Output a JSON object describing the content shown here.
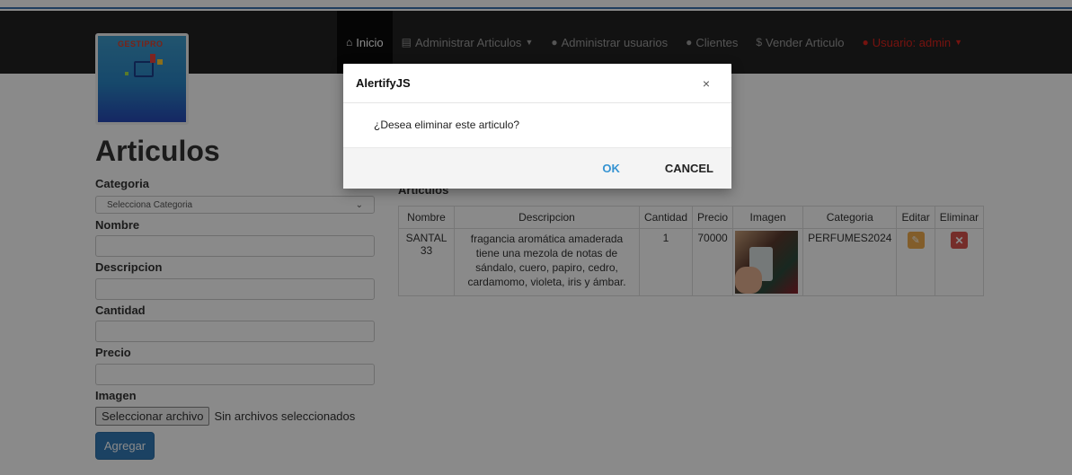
{
  "logo": {
    "text": "GESTIPRO"
  },
  "nav": {
    "items": [
      {
        "label": "Inicio",
        "icon": "home-icon"
      },
      {
        "label": "Administrar Articulos",
        "icon": "list-icon"
      },
      {
        "label": "Administrar usuarios",
        "icon": "user-icon"
      },
      {
        "label": "Clientes",
        "icon": "user-icon"
      },
      {
        "label": "Vender Articulo",
        "icon": "dollar-icon"
      },
      {
        "label": "Usuario: admin",
        "icon": "user-icon"
      }
    ]
  },
  "form": {
    "title": "Articulos",
    "categoria_label": "Categoria",
    "categoria_selected": "Selecciona Categoria",
    "nombre_label": "Nombre",
    "descripcion_label": "Descripcion",
    "cantidad_label": "Cantidad",
    "precio_label": "Precio",
    "imagen_label": "Imagen",
    "file_button": "Seleccionar archivo",
    "file_status": "Sin archivos seleccionados",
    "submit_label": "Agregar"
  },
  "table": {
    "heading": "Articulos",
    "columns": [
      "Nombre",
      "Descripcion",
      "Cantidad",
      "Precio",
      "Imagen",
      "Categoria",
      "Editar",
      "Eliminar"
    ],
    "rows": [
      {
        "nombre": "SANTAL 33",
        "descripcion": "fragancia aromática amaderada tiene una mezola de notas de sándalo, cuero, papiro, cedro, cardamomo, violeta, iris y ámbar.",
        "cantidad": "1",
        "precio": "70000",
        "categoria": "PERFUMES2024"
      }
    ]
  },
  "dialog": {
    "title": "AlertifyJS",
    "close": "×",
    "message": "¿Desea eliminar este articulo?",
    "ok_label": "OK",
    "cancel_label": "CANCEL"
  },
  "colors": {
    "navbar": "#222222",
    "primary": "#337ab7",
    "danger": "#d9534f",
    "warning": "#f0ad4e",
    "ok": "#3593d2"
  }
}
